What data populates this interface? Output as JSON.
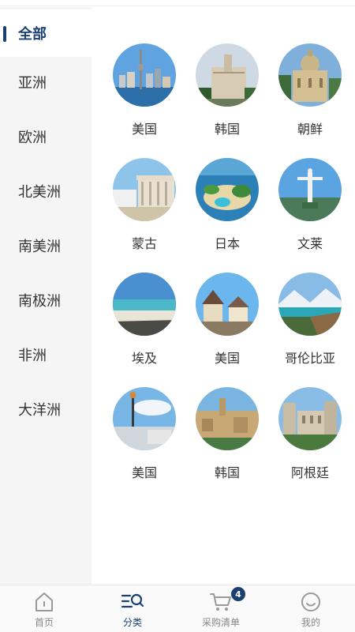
{
  "sidebar": {
    "items": [
      {
        "label": "全部"
      },
      {
        "label": "亚洲"
      },
      {
        "label": "欧洲"
      },
      {
        "label": "北美洲"
      },
      {
        "label": "南美洲"
      },
      {
        "label": "南极洲"
      },
      {
        "label": "非洲"
      },
      {
        "label": "大洋洲"
      }
    ],
    "active_color": "#1c3f72"
  },
  "grid": {
    "items": [
      {
        "label": "美国"
      },
      {
        "label": "韩国"
      },
      {
        "label": "朝鲜"
      },
      {
        "label": "蒙古"
      },
      {
        "label": "日本"
      },
      {
        "label": "文莱"
      },
      {
        "label": "埃及"
      },
      {
        "label": "美国"
      },
      {
        "label": "哥伦比亚"
      },
      {
        "label": "美国"
      },
      {
        "label": "韩国"
      },
      {
        "label": "阿根廷"
      }
    ]
  },
  "tabbar": {
    "tabs": [
      {
        "label": "首页",
        "icon": "home-icon"
      },
      {
        "label": "分类",
        "icon": "category-search-icon"
      },
      {
        "label": "采购清单",
        "icon": "cart-icon",
        "badge": "4"
      },
      {
        "label": "我的",
        "icon": "smile-profile-icon"
      }
    ],
    "active_tab": "分类"
  }
}
